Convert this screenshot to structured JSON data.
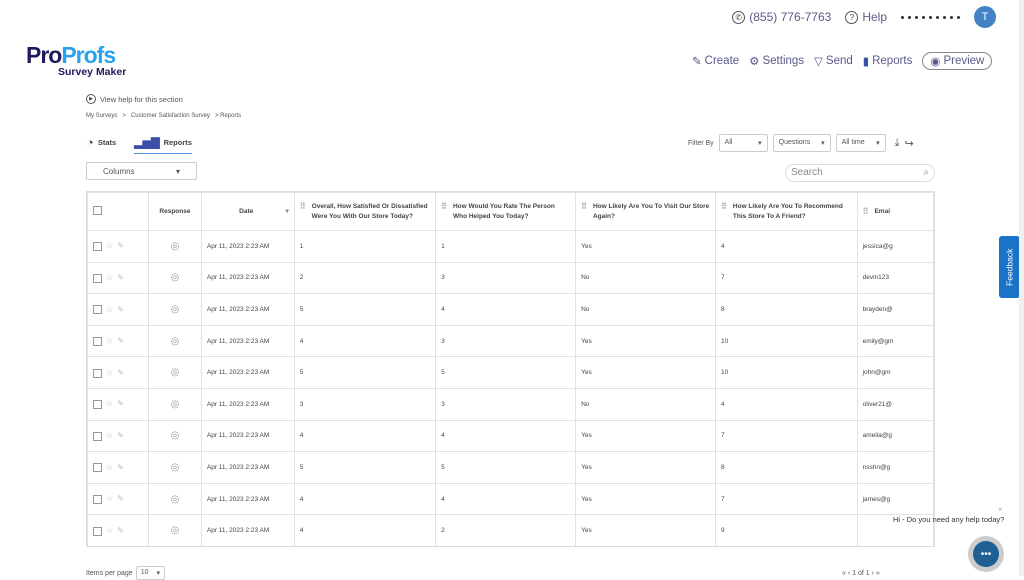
{
  "header": {
    "phone": "(855) 776-7763",
    "help": "Help",
    "avatar_initial": "T"
  },
  "logo": {
    "part1": "Pro",
    "part2": "Profs",
    "sub": "Survey Maker"
  },
  "nav": {
    "create": "Create",
    "settings": "Settings",
    "send": "Send",
    "reports": "Reports",
    "preview": "Preview"
  },
  "help_link": "View help for this section",
  "breadcrumb": [
    "My Surveys",
    ">",
    "Customer Satisfaction Survey",
    "> Reports"
  ],
  "tabs": {
    "stats": "Stats",
    "reports": "Reports"
  },
  "columns_dropdown": "Columns",
  "filters": {
    "label": "Filter By",
    "all": "All",
    "questions": "Questions",
    "time": "All time"
  },
  "search": {
    "placeholder": "Search"
  },
  "table": {
    "headers": [
      "Response",
      "Date",
      "Overall, How Satisfied Or Dissatisfied Were You With Our Store Today?",
      "How Would You Rate The Person Who Helped You Today?",
      "How Likely Are You To Visit Our Store Again?",
      "How Likely Are You To Recommend This Store To A Friend?",
      "Emai"
    ],
    "rows": [
      [
        "Apr 11, 2023 2:23 AM",
        "1",
        "1",
        "Yes",
        "4",
        "jessica@g"
      ],
      [
        "Apr 11, 2023 2:23 AM",
        "2",
        "3",
        "No",
        "7",
        "devin123"
      ],
      [
        "Apr 11, 2023 2:23 AM",
        "5",
        "4",
        "No",
        "8",
        "brayden@"
      ],
      [
        "Apr 11, 2023 2:23 AM",
        "4",
        "3",
        "Yes",
        "10",
        "emily@gm"
      ],
      [
        "Apr 11, 2023 2:23 AM",
        "5",
        "5",
        "Yes",
        "10",
        "john@gm"
      ],
      [
        "Apr 11, 2023 2:23 AM",
        "3",
        "3",
        "No",
        "4",
        "oliver21@"
      ],
      [
        "Apr 11, 2023 2:23 AM",
        "4",
        "4",
        "Yes",
        "7",
        "amelia@g"
      ],
      [
        "Apr 11, 2023 2:23 AM",
        "5",
        "5",
        "Yes",
        "8",
        "nsshn@g"
      ],
      [
        "Apr 11, 2023 2:23 AM",
        "4",
        "4",
        "Yes",
        "7",
        "james@g"
      ],
      [
        "Apr 11, 2023 2:23 AM",
        "4",
        "2",
        "Yes",
        "9",
        ""
      ]
    ]
  },
  "feedback": "Feedback",
  "chat": {
    "message": "Hi - Do you need any help today?",
    "close": "×"
  },
  "pagination": {
    "items_per_page_label": "Items per page",
    "items_per_page": "10",
    "pager": "«  ‹  1 of 1  ›  »"
  }
}
